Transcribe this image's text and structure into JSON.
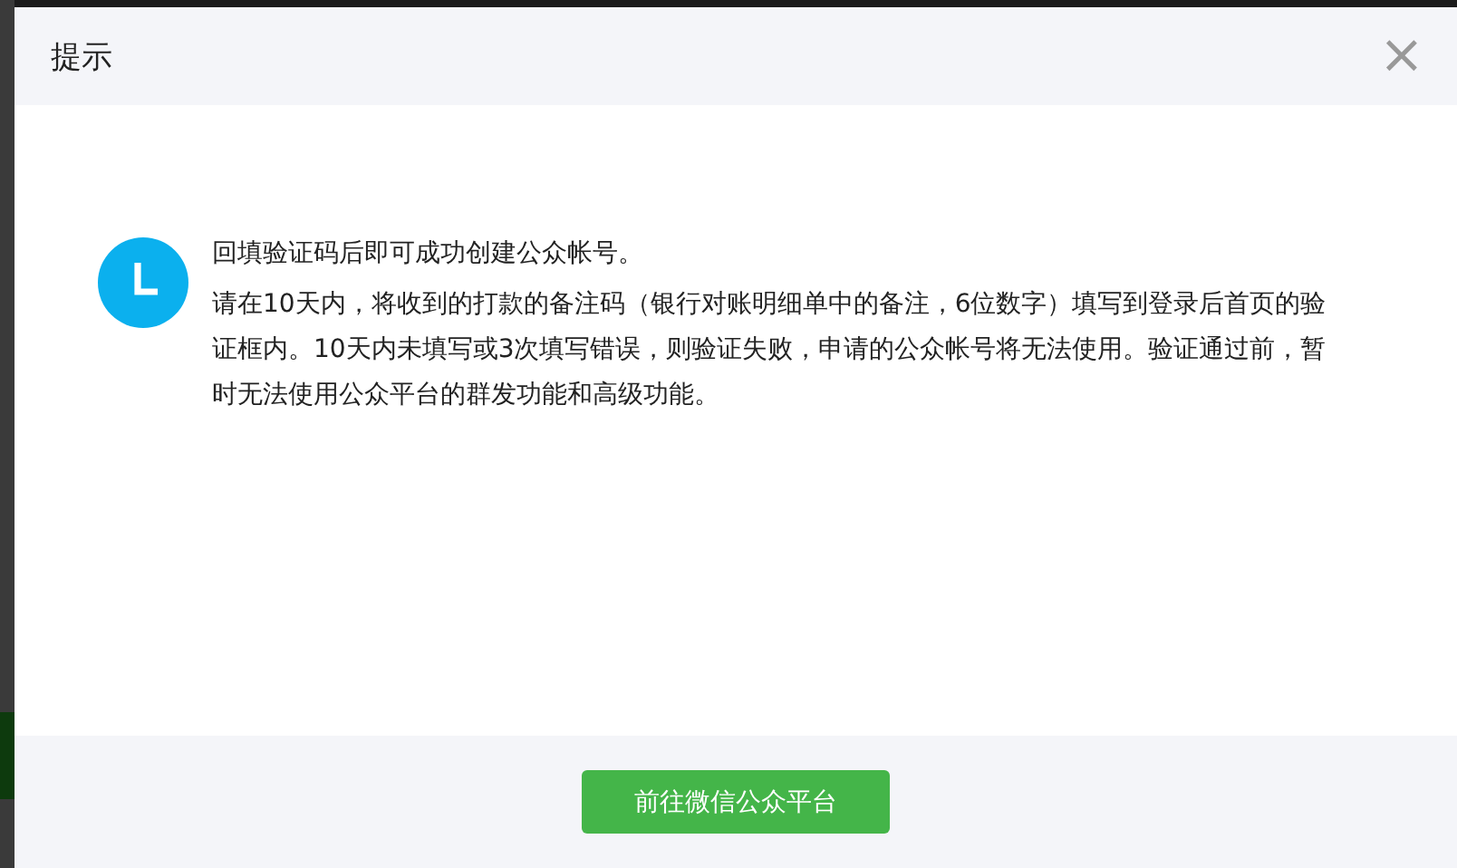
{
  "dialog": {
    "title": "提示",
    "close": "×",
    "message": {
      "headline": "回填验证码后即可成功创建公众帐号。",
      "body": "请在10天内，将收到的打款的备注码（银行对账明细单中的备注，6位数字）填写到登录后首页的验证框内。10天内未填写或3次填写错误，则验证失败，申请的公众帐号将无法使用。验证通过前，暂时无法使用公众平台的群发功能和高级功能。"
    },
    "buttons": [
      {
        "label": "前往微信公众平台",
        "kind": "primary"
      }
    ]
  }
}
